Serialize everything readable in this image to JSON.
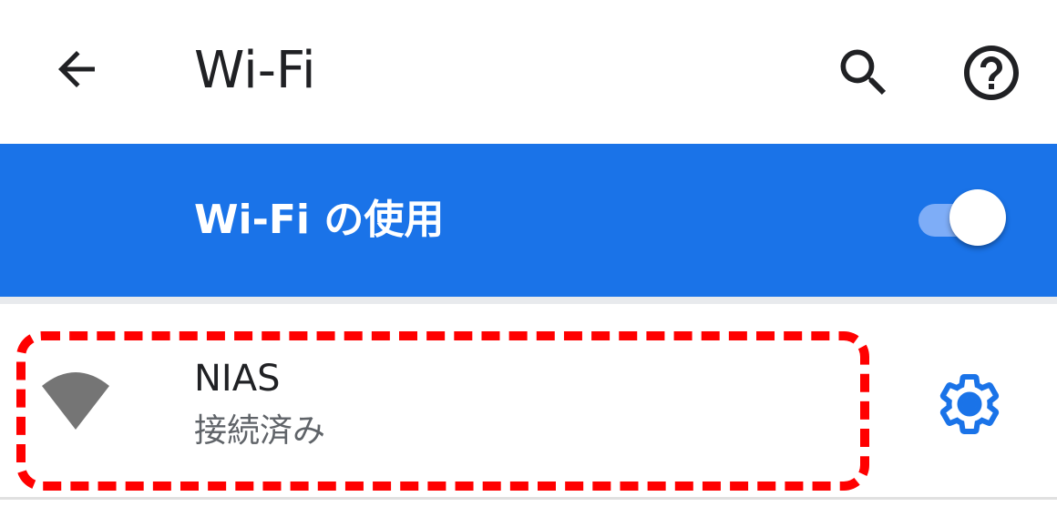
{
  "app_bar": {
    "title": "Wi-Fi",
    "icons": {
      "back": "arrow-back-icon",
      "search": "search-icon",
      "help": "help-circle-icon"
    }
  },
  "master_switch": {
    "label": "Wi-Fi の使用",
    "state": "on"
  },
  "network": {
    "name": "NIAS",
    "status": "接続済み",
    "icons": {
      "signal": "wifi-signal-icon",
      "settings": "gear-icon"
    }
  },
  "colors": {
    "accent": "#1a73e8",
    "highlight": "#ff0000",
    "title_text": "#202124",
    "secondary_text": "#5f6368",
    "wifi_icon": "#757575"
  }
}
